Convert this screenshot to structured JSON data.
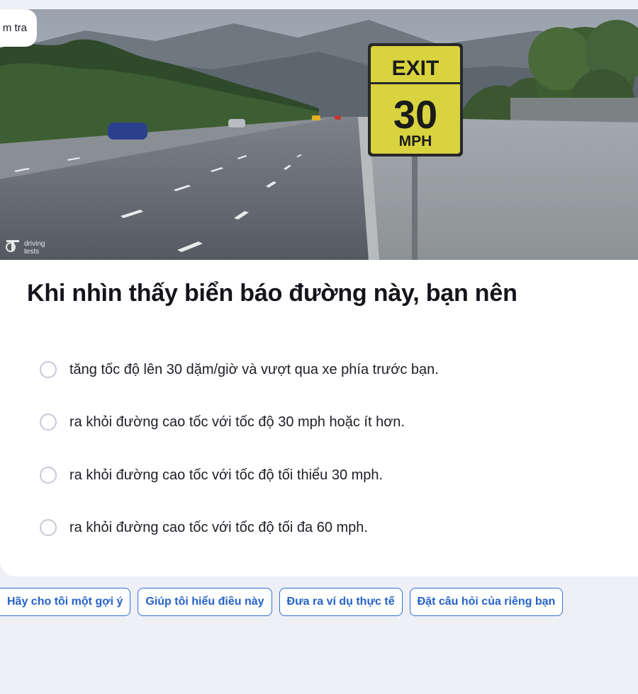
{
  "back_button": {
    "label": "m tra"
  },
  "image": {
    "sign": {
      "line1": "EXIT",
      "line2": "30",
      "line3": "MPH"
    },
    "watermark": {
      "line1": "driving",
      "line2": "tests"
    }
  },
  "question": {
    "text": "Khi nhìn thấy biển báo đường này, bạn nên"
  },
  "options": [
    {
      "label": "tăng tốc độ lên 30 dặm/giờ và vượt qua xe phía trước bạn."
    },
    {
      "label": "ra khỏi đường cao tốc với tốc độ 30 mph hoặc ít hơn."
    },
    {
      "label": "ra khỏi đường cao tốc với tốc độ tối thiểu 30 mph."
    },
    {
      "label": "ra khỏi đường cao tốc với tốc độ tối đa 60 mph."
    }
  ],
  "help_chips": [
    {
      "label": "Hãy cho tôi một gợi ý"
    },
    {
      "label": "Giúp tôi hiểu điều này"
    },
    {
      "label": "Đưa ra ví dụ thực tế"
    },
    {
      "label": "Đặt câu hỏi của riêng bạn"
    }
  ],
  "colors": {
    "accent": "#2563c9",
    "sign_yellow": "#d8d33f",
    "background": "#eff0f6"
  }
}
